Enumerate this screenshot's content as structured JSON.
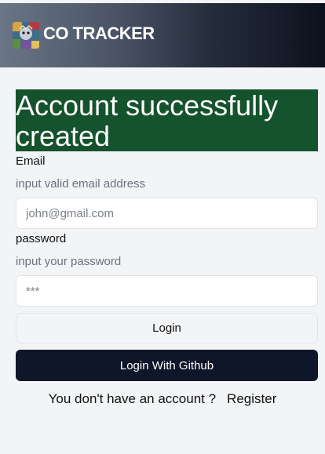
{
  "header": {
    "brand": "CO TRACKER",
    "logo_icon": "painted-avatar-logo-icon"
  },
  "alert": {
    "message": "Account successfully created",
    "color": "#15522e"
  },
  "form": {
    "email": {
      "label": "Email",
      "hint": "input valid email address",
      "placeholder": "john@gmail.com",
      "value": ""
    },
    "password": {
      "label": "password",
      "hint": "input your password",
      "placeholder": "***",
      "value": ""
    },
    "login_label": "Login",
    "github_label": "Login With Github"
  },
  "footer": {
    "prompt": "You don't have an account ?",
    "register_label": "Register"
  },
  "colors": {
    "primary_button": "#0f1629",
    "background": "#f2f4f6"
  }
}
